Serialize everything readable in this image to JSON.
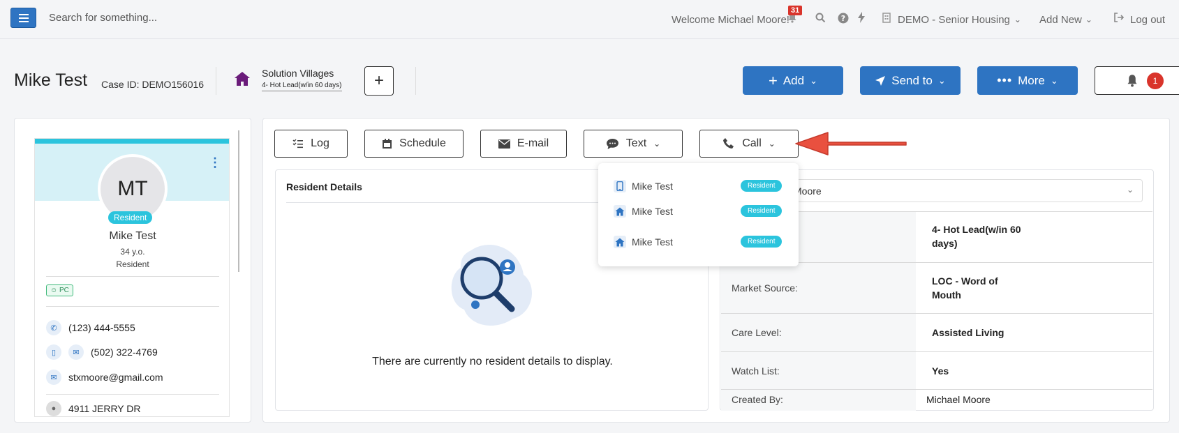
{
  "topnav": {
    "search_placeholder": "Search for something...",
    "welcome": "Welcome Michael Moore!",
    "notification_count": "31",
    "workspace": "DEMO - Senior Housing",
    "add_new": "Add New",
    "logout": "Log out"
  },
  "header": {
    "title": "Mike Test",
    "case_id": "Case ID: DEMO156016",
    "community": "Solution Villages",
    "status": "4- Hot Lead(w/in 60 days)",
    "add_label": "Add",
    "send_to_label": "Send to",
    "more_label": "More",
    "alert_count": "1"
  },
  "profile": {
    "initials": "MT",
    "badge": "Resident",
    "name": "Mike Test",
    "age": "34 y.o.",
    "type": "Resident",
    "tag": "PC",
    "phone": "(123) 444-5555",
    "mobile": "(502) 322-4769",
    "email": "stxmoore@gmail.com",
    "address": "4911 JERRY DR"
  },
  "tabs": {
    "log": "Log",
    "schedule": "Schedule",
    "email": "E-mail",
    "text": "Text",
    "call": "Call"
  },
  "call_dropdown": {
    "items": [
      {
        "name": "Mike Test",
        "badge": "Resident",
        "icon": "mobile-phone-icon"
      },
      {
        "name": "Mike Test",
        "badge": "Resident",
        "icon": "home-icon"
      },
      {
        "name": "Mike Test",
        "badge": "Resident",
        "icon": "home-icon"
      }
    ]
  },
  "resident_details": {
    "title": "Resident Details",
    "empty_message": "There are currently no resident details to display."
  },
  "info": {
    "contact_value": "Moore",
    "rows": [
      {
        "label": "",
        "value": "4- Hot Lead(w/in 60 days)"
      },
      {
        "label": "Market Source:",
        "value": "LOC - Word of Mouth"
      },
      {
        "label": "Care Level:",
        "value": "Assisted Living"
      },
      {
        "label": "Watch List:",
        "value": "Yes"
      },
      {
        "label": "Created By:",
        "value": "Michael Moore"
      }
    ]
  },
  "colors": {
    "primary": "#2e74c2",
    "accent_cyan": "#2bc4dd",
    "danger": "#d9342b",
    "house_purple": "#6a1b7a"
  }
}
